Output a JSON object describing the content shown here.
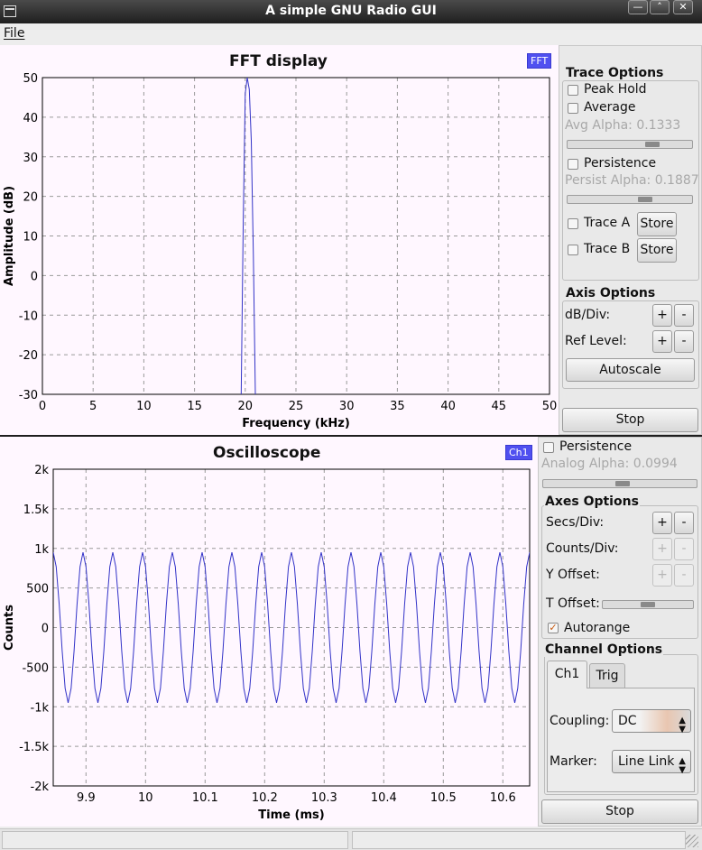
{
  "window": {
    "title": "A simple GNU Radio GUI",
    "buttons": [
      "—",
      "˄",
      "✕"
    ]
  },
  "menu": {
    "file": "File"
  },
  "fft": {
    "title": "FFT display",
    "legend": "FFT",
    "trace_options": {
      "title": "Trace Options",
      "peak_hold": "Peak Hold",
      "average": "Average",
      "avg_alpha": "Avg Alpha: 0.1333",
      "avg_alpha_value": 0.1333,
      "persistence": "Persistence",
      "persist_alpha": "Persist Alpha: 0.1887",
      "persist_alpha_value": 0.1887,
      "trace_a": "Trace A",
      "trace_b": "Trace B",
      "store": "Store"
    },
    "axis_options": {
      "title": "Axis Options",
      "db_div": "dB/Div:",
      "ref_level": "Ref Level:",
      "plus": "+",
      "minus": "-",
      "autoscale": "Autoscale"
    },
    "stop": "Stop"
  },
  "scope": {
    "title": "Oscilloscope",
    "legend": "Ch1",
    "persistence": "Persistence",
    "analog_alpha": "Analog Alpha: 0.0994",
    "analog_alpha_value": 0.0994,
    "axes_options": {
      "title": "Axes Options",
      "secs_div": "Secs/Div:",
      "counts_div": "Counts/Div:",
      "y_offset": "Y Offset:",
      "t_offset": "T Offset:",
      "autorange": "Autorange",
      "autorange_checked": true,
      "plus": "+",
      "minus": "-"
    },
    "channel_options": {
      "title": "Channel Options",
      "tabs": [
        "Ch1",
        "Trig"
      ],
      "coupling_label": "Coupling:",
      "coupling_value": "DC",
      "marker_label": "Marker:",
      "marker_value": "Line Link"
    },
    "stop": "Stop"
  },
  "colors": {
    "trace": "#3434c8",
    "grid": "#9a9a9a",
    "legend": "#5050f0"
  },
  "chart_data": [
    {
      "type": "line",
      "title": "FFT display",
      "xlabel": "Frequency (kHz)",
      "ylabel": "Amplitude (dB)",
      "xlim": [
        0,
        50
      ],
      "ylim": [
        -30,
        50
      ],
      "xticks": [
        "0",
        "5",
        "10",
        "15",
        "20",
        "25",
        "30",
        "35",
        "40",
        "45",
        "50"
      ],
      "yticks": [
        "50",
        "40",
        "30",
        "20",
        "10",
        "0",
        "-10",
        "-20",
        "-30"
      ],
      "grid": true,
      "legend": "top-right",
      "series": [
        {
          "name": "FFT",
          "x": [
            19.6,
            19.8,
            20.0,
            20.2,
            20.4,
            20.6,
            20.8,
            21.0
          ],
          "y": [
            -30,
            14,
            46,
            50,
            47,
            34,
            5,
            -30
          ]
        }
      ]
    },
    {
      "type": "line",
      "title": "Oscilloscope",
      "xlabel": "Time (ms)",
      "ylabel": "Counts",
      "xlim": [
        9.845,
        10.645
      ],
      "ylim": [
        -2000,
        2000
      ],
      "xticks": [
        "9.9",
        "10",
        "10.1",
        "10.2",
        "10.3",
        "10.4",
        "10.5",
        "10.6"
      ],
      "yticks": [
        "2k",
        "1.5k",
        "1k",
        "500",
        "0",
        "-500",
        "-1k",
        "-1.5k",
        "-2k"
      ],
      "grid": true,
      "legend": "top-right",
      "series": [
        {
          "name": "Ch1",
          "amplitude": 950,
          "period_ms": 0.05,
          "phase_ms": 9.845
        }
      ]
    }
  ]
}
